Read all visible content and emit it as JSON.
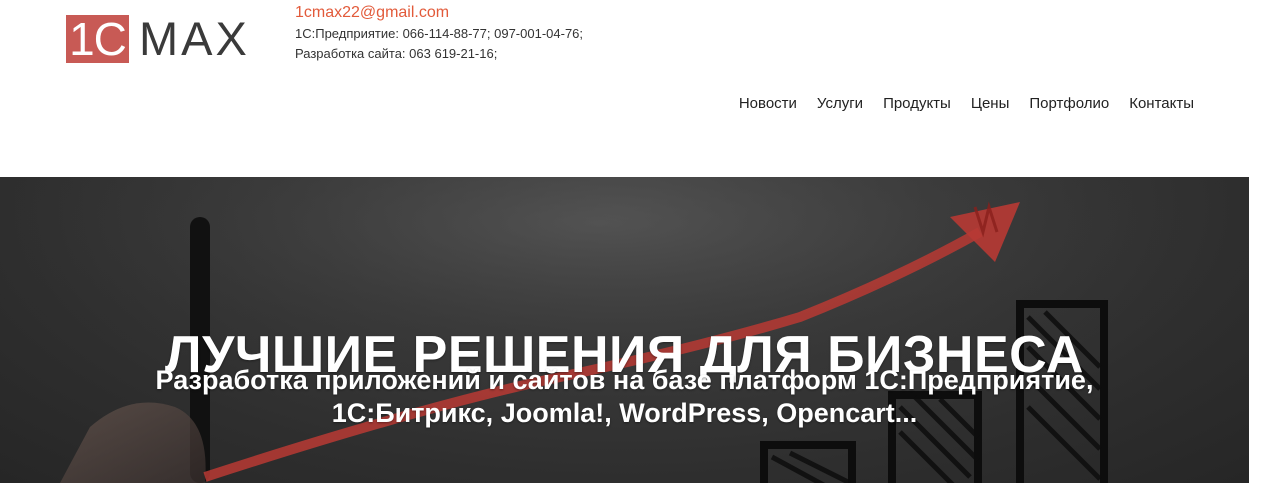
{
  "header": {
    "logo": {
      "box_text": "1C",
      "brand_text": "MAX"
    },
    "contact": {
      "email": "1cmax22@gmail.com",
      "phone_1c": "1С:Предприятие: 066-114-88-77; 097-001-04-76;",
      "phone_web": "Разработка сайта: 063 619-21-16;"
    },
    "nav": [
      {
        "label": "Новости"
      },
      {
        "label": "Услуги"
      },
      {
        "label": "Продукты"
      },
      {
        "label": "Цены"
      },
      {
        "label": "Портфолио"
      },
      {
        "label": "Контакты"
      }
    ]
  },
  "hero": {
    "title": "ЛУЧШИЕ РЕШЕНИЯ ДЛЯ БИЗНЕСА",
    "subtitle_line1": "Разработка приложений и сайтов на базе платформ 1С:Предприятие,",
    "subtitle_line2": "1С:Битрикс, Joomla!, WordPress, Opencart..."
  },
  "colors": {
    "logo_red": "#c85a55",
    "email_accent": "#e25a3a",
    "hero_arrow_red": "#b83a34",
    "hero_dark": "#2e2e2e"
  }
}
